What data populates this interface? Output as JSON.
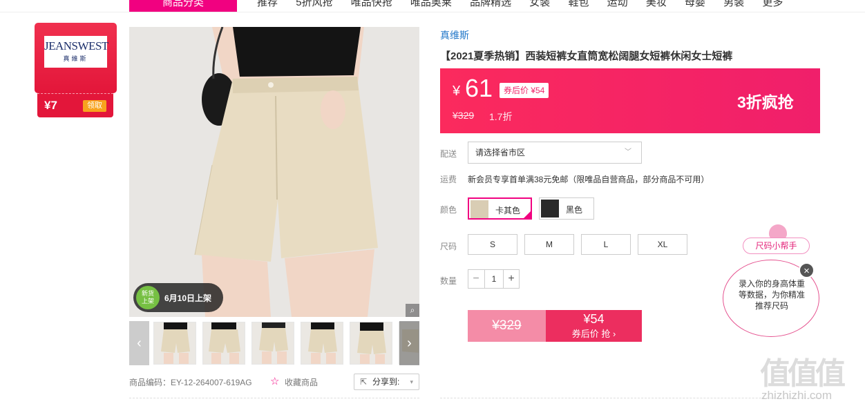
{
  "nav": {
    "category_label": "商品分类",
    "links": [
      "推荐",
      "5折风抢",
      "唯品快抢",
      "唯品奥莱",
      "品牌精选",
      "女装",
      "鞋包",
      "运动",
      "美妆",
      "母婴",
      "男装",
      "更多"
    ]
  },
  "brand_badge": {
    "logo_text": "JEANSWEST",
    "logo_sub": "真維斯",
    "coupon_amount": "¥7",
    "coupon_button": "领取"
  },
  "gallery": {
    "launch_badge_top": "新货",
    "launch_badge_bottom": "上架",
    "launch_text": "6月10日上架",
    "zoom_icon": "zoom-icon",
    "prev_icon": "‹",
    "next_icon": "›",
    "thumb_count": 6
  },
  "meta": {
    "product_code": "商品编码：EY-12-264007-619AG",
    "favorite_label": "收藏商品",
    "share_label": "分享到:"
  },
  "product": {
    "brand": "真维斯",
    "title": "【2021夏季热销】西装短裤女直筒宽松阔腿女短裤休闲女士短裤"
  },
  "price": {
    "currency": "¥",
    "current": "61",
    "coupon_badge": "券后价 ¥54",
    "original": "¥329",
    "discount": "1.7折",
    "promo": "3折疯抢"
  },
  "delivery": {
    "label": "配送",
    "placeholder": "请选择省市区"
  },
  "freight": {
    "label": "运费",
    "text": "新会员专享首单满38元免邮（限唯品自营商品，部分商品不可用）"
  },
  "colors": {
    "label": "颜色",
    "options": [
      {
        "name": "卡其色",
        "selected": true,
        "swatch": "#d9cdb4"
      },
      {
        "name": "黑色",
        "selected": false,
        "swatch": "#2a2a2a"
      }
    ]
  },
  "sizes": {
    "label": "尺码",
    "options": [
      "S",
      "M",
      "L",
      "XL"
    ]
  },
  "quantity": {
    "label": "数量",
    "value": "1",
    "minus": "−",
    "plus": "+"
  },
  "buy": {
    "original": "¥329",
    "coupon_price": "¥54",
    "coupon_action": "券后价 抢 ›"
  },
  "size_helper": {
    "pill_label": "尺码小帮手",
    "bubble_text": "录入你的身高体重等数据，为你精准推荐尺码",
    "close": "×"
  },
  "watermark": {
    "big": "值值值",
    "url": "zhizhizhi.com"
  },
  "colors_theme": {
    "accent": "#f10180",
    "price_bg": "#fb2a5d",
    "brand_red": "#e3163a",
    "link_blue": "#2378c9"
  }
}
